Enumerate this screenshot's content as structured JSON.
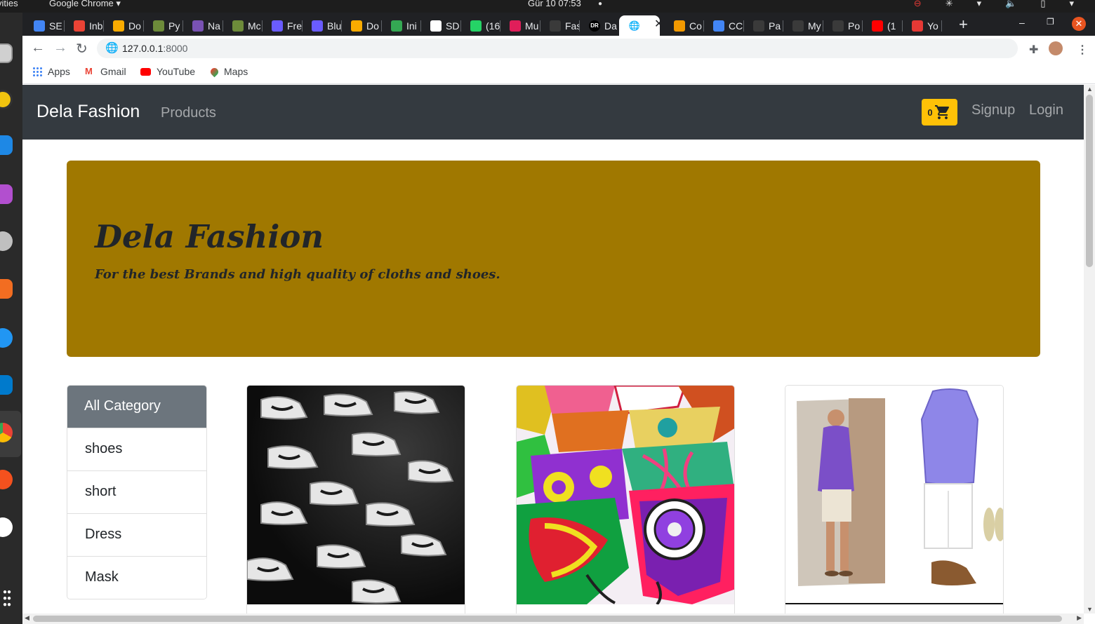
{
  "system": {
    "activities": "vities",
    "app_menu": "Google Chrome ▾",
    "clock": "Gür 10  07:53"
  },
  "browser": {
    "tabs": [
      {
        "label": "SE",
        "icon": "docs-icon",
        "color": "#4285f4"
      },
      {
        "label": "Inb",
        "icon": "gmail-icon",
        "color": "#ea4335"
      },
      {
        "label": "Do",
        "icon": "analytics-icon",
        "color": "#f9ab00"
      },
      {
        "label": "Py",
        "icon": "palm-icon",
        "color": "#6d8b3a"
      },
      {
        "label": "Na",
        "icon": "bootstrap-icon",
        "color": "#7952b3"
      },
      {
        "label": "Mc",
        "icon": "palm-icon",
        "color": "#6d8b3a"
      },
      {
        "label": "Fre",
        "icon": "canva-icon",
        "color": "#6a5cff"
      },
      {
        "label": "Blu",
        "icon": "canva-icon",
        "color": "#6a5cff"
      },
      {
        "label": "Do",
        "icon": "analytics-icon",
        "color": "#f9ab00"
      },
      {
        "label": "Ini",
        "icon": "cloud-icon",
        "color": "#34a853"
      },
      {
        "label": "SD",
        "icon": "google-icon",
        "color": "#ffffff"
      },
      {
        "label": "(16",
        "icon": "whatsapp-icon",
        "color": "#25d366"
      },
      {
        "label": "Mu",
        "icon": "slack-icon",
        "color": "#e01e5a"
      },
      {
        "label": "Fas",
        "icon": "github-icon",
        "color": "#3a3a3a"
      },
      {
        "label": "Da",
        "icon": "dr-icon",
        "color": "#000000"
      },
      {
        "label": "",
        "icon": "globe-icon",
        "color": "#202124",
        "active": true
      },
      {
        "label": "Co",
        "icon": "loader-icon",
        "color": "#f29900"
      },
      {
        "label": "CC",
        "icon": "docs-icon",
        "color": "#4285f4"
      },
      {
        "label": "Pa",
        "icon": "github-icon",
        "color": "#3a3a3a"
      },
      {
        "label": "My",
        "icon": "github-icon",
        "color": "#3a3a3a"
      },
      {
        "label": "Po",
        "icon": "github-icon",
        "color": "#3a3a3a"
      },
      {
        "label": "(1",
        "icon": "youtube-icon",
        "color": "#ff0000"
      },
      {
        "label": "Yo",
        "icon": "download-icon",
        "color": "#e53935"
      }
    ],
    "url_host": "127.0.0.1",
    "url_port": ":8000",
    "bookmarks": [
      {
        "label": "Apps",
        "icon": "apps-grid-icon"
      },
      {
        "label": "Gmail",
        "icon": "gmail-icon"
      },
      {
        "label": "YouTube",
        "icon": "youtube-icon"
      },
      {
        "label": "Maps",
        "icon": "maps-pin-icon"
      }
    ]
  },
  "site": {
    "brand": "Dela Fashion",
    "nav_products": "Products",
    "cart_count": "0",
    "nav_signup": "Signup",
    "nav_login": "Login",
    "jumbotron_title": "Dela Fashion",
    "jumbotron_subtitle": "For the best Brands and high quality of cloths and shoes.",
    "jumbotron_color": "#a07800",
    "categories_header": "All Category",
    "categories": [
      "shoes",
      "short",
      "Dress",
      "Mask"
    ],
    "products": [
      {
        "image": "sneakers-wall-image"
      },
      {
        "image": "african-print-masks-image"
      },
      {
        "image": "purple-shirt-outfit-image"
      }
    ]
  }
}
